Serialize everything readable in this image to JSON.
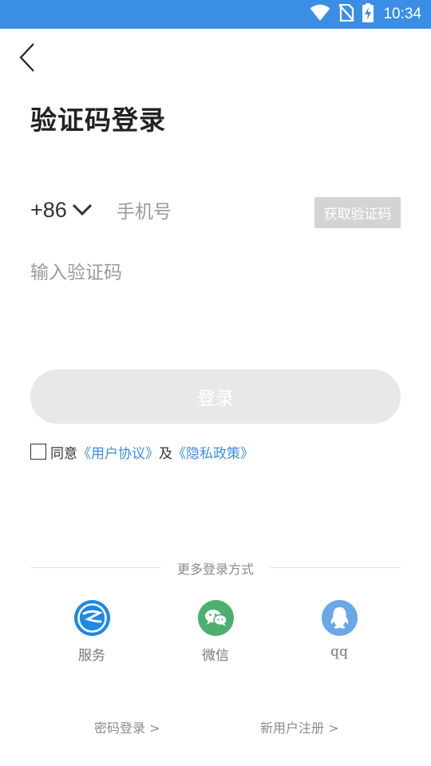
{
  "status_bar": {
    "time": "10:34",
    "icons": [
      "wifi-icon",
      "no-sim-icon",
      "battery-charging-icon"
    ],
    "background": "#3a8ee6"
  },
  "header": {
    "back_icon": "chevron-left-icon",
    "title": "验证码登录"
  },
  "form": {
    "country_code": "+86",
    "phone_placeholder": "手机号",
    "get_code_label": "获取验证码",
    "code_placeholder": "输入验证码",
    "login_label": "登录"
  },
  "agreement": {
    "prefix": "同意",
    "user_agreement": "《用户协议》",
    "conjunction": "及",
    "privacy_policy": "《隐私政策》",
    "link_color": "#3a8ee6",
    "checked": false
  },
  "more_login": {
    "title": "更多登录方式",
    "options": [
      {
        "label": "服务",
        "icon": "service-icon",
        "color": "#1e88e5"
      },
      {
        "label": "微信",
        "icon": "wechat-icon",
        "color": "#4caf6e"
      },
      {
        "label": "qq",
        "icon": "qq-icon",
        "color": "#6aa7e8"
      }
    ]
  },
  "footer": {
    "password_login": "密码登录 >",
    "register": "新用户注册 >"
  }
}
